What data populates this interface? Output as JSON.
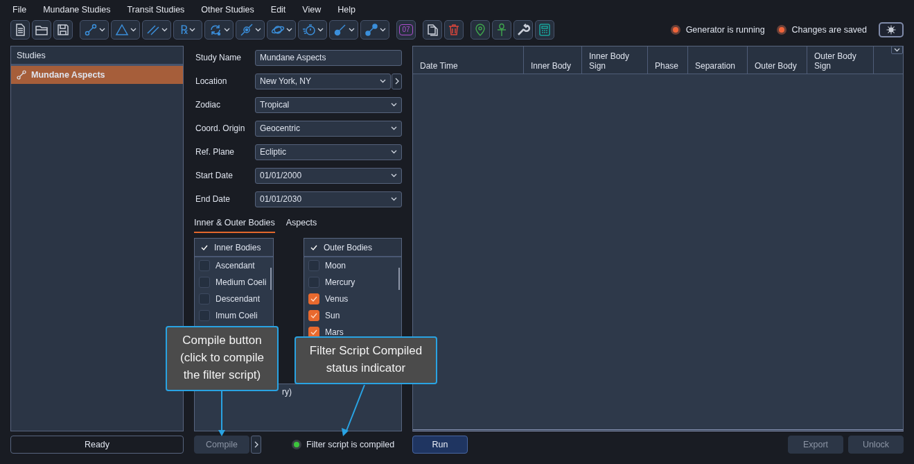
{
  "menu": [
    "File",
    "Mundane Studies",
    "Transit Studies",
    "Other Studies",
    "Edit",
    "View",
    "Help"
  ],
  "toolbar": [
    {
      "items": [
        {
          "kind": "button"
        },
        {
          "kind": "button"
        },
        {
          "kind": "button"
        }
      ]
    },
    {
      "items": [
        {
          "kind": "dropdown"
        },
        {
          "kind": "dropdown"
        },
        {
          "kind": "dropdown"
        },
        {
          "kind": "dropdown",
          "glyph": "℞"
        },
        {
          "kind": "dropdown"
        },
        {
          "kind": "dropdown"
        },
        {
          "kind": "dropdown"
        },
        {
          "kind": "dropdown"
        },
        {
          "kind": "dropdown"
        },
        {
          "kind": "dropdown"
        }
      ]
    },
    {
      "items": [
        {
          "kind": "button",
          "glyph": "07"
        }
      ]
    },
    {
      "items": [
        {
          "kind": "button"
        },
        {
          "kind": "button"
        }
      ]
    },
    {
      "items": [
        {
          "kind": "button"
        },
        {
          "kind": "button"
        },
        {
          "kind": "button"
        },
        {
          "kind": "button"
        }
      ]
    }
  ],
  "indicators": [
    {
      "label": "Generator is running",
      "on": true,
      "color": "#f0643a"
    },
    {
      "label": "Changes are saved",
      "on": true,
      "color": "#f0643a"
    }
  ],
  "studies": {
    "title": "Studies",
    "items": [
      {
        "label": "Mundane Aspects",
        "selected": true
      }
    ]
  },
  "form": [
    {
      "label": "Study Name",
      "kind": "input",
      "value": "Mundane Aspects"
    },
    {
      "label": "Location",
      "kind": "select_more",
      "value": "New York, NY"
    },
    {
      "label": "Zodiac",
      "kind": "select",
      "value": "Tropical"
    },
    {
      "label": "Coord. Origin",
      "kind": "select",
      "value": "Geocentric"
    },
    {
      "label": "Ref. Plane",
      "kind": "select",
      "value": "Ecliptic"
    },
    {
      "label": "Start Date",
      "kind": "select",
      "value": "01/01/2000"
    },
    {
      "label": "End Date",
      "kind": "select",
      "value": "01/01/2030"
    }
  ],
  "tabs": [
    {
      "label": "Inner & Outer Bodies",
      "selected": true
    },
    {
      "label": "Aspects",
      "selected": false
    }
  ],
  "lists": [
    {
      "title": "Inner Bodies",
      "checked": true,
      "items": [
        {
          "label": "Ascendant",
          "checked": false
        },
        {
          "label": "Medium Coeli",
          "checked": false
        },
        {
          "label": "Descendant",
          "checked": false
        },
        {
          "label": "Imum Coeli",
          "checked": false
        }
      ]
    },
    {
      "title": "Outer Bodies",
      "checked": true,
      "items": [
        {
          "label": "Moon",
          "checked": false
        },
        {
          "label": "Mercury",
          "checked": false
        },
        {
          "label": "Venus",
          "checked": true
        },
        {
          "label": "Sun",
          "checked": true
        },
        {
          "label": "Mars",
          "checked": true
        }
      ]
    }
  ],
  "filter_text": "ry)",
  "table": {
    "columns": [
      "Date Time",
      "Inner Body",
      "Inner Body Sign",
      "Phase",
      "Separation",
      "Outer Body",
      "Outer Body Sign"
    ]
  },
  "status_bar": "Ready",
  "compile": {
    "label": "Compile",
    "disabled": true
  },
  "compiled_status": {
    "label": "Filter script is compiled",
    "color": "#3cc43c"
  },
  "run": {
    "label": "Run",
    "disabled": false
  },
  "export": {
    "label": "Export",
    "disabled": true
  },
  "unlock": {
    "label": "Unlock",
    "disabled": true
  },
  "callouts": [
    {
      "text": "Compile button (click to compile the filter script)"
    },
    {
      "text": "Filter Script Compiled status indicator"
    }
  ]
}
